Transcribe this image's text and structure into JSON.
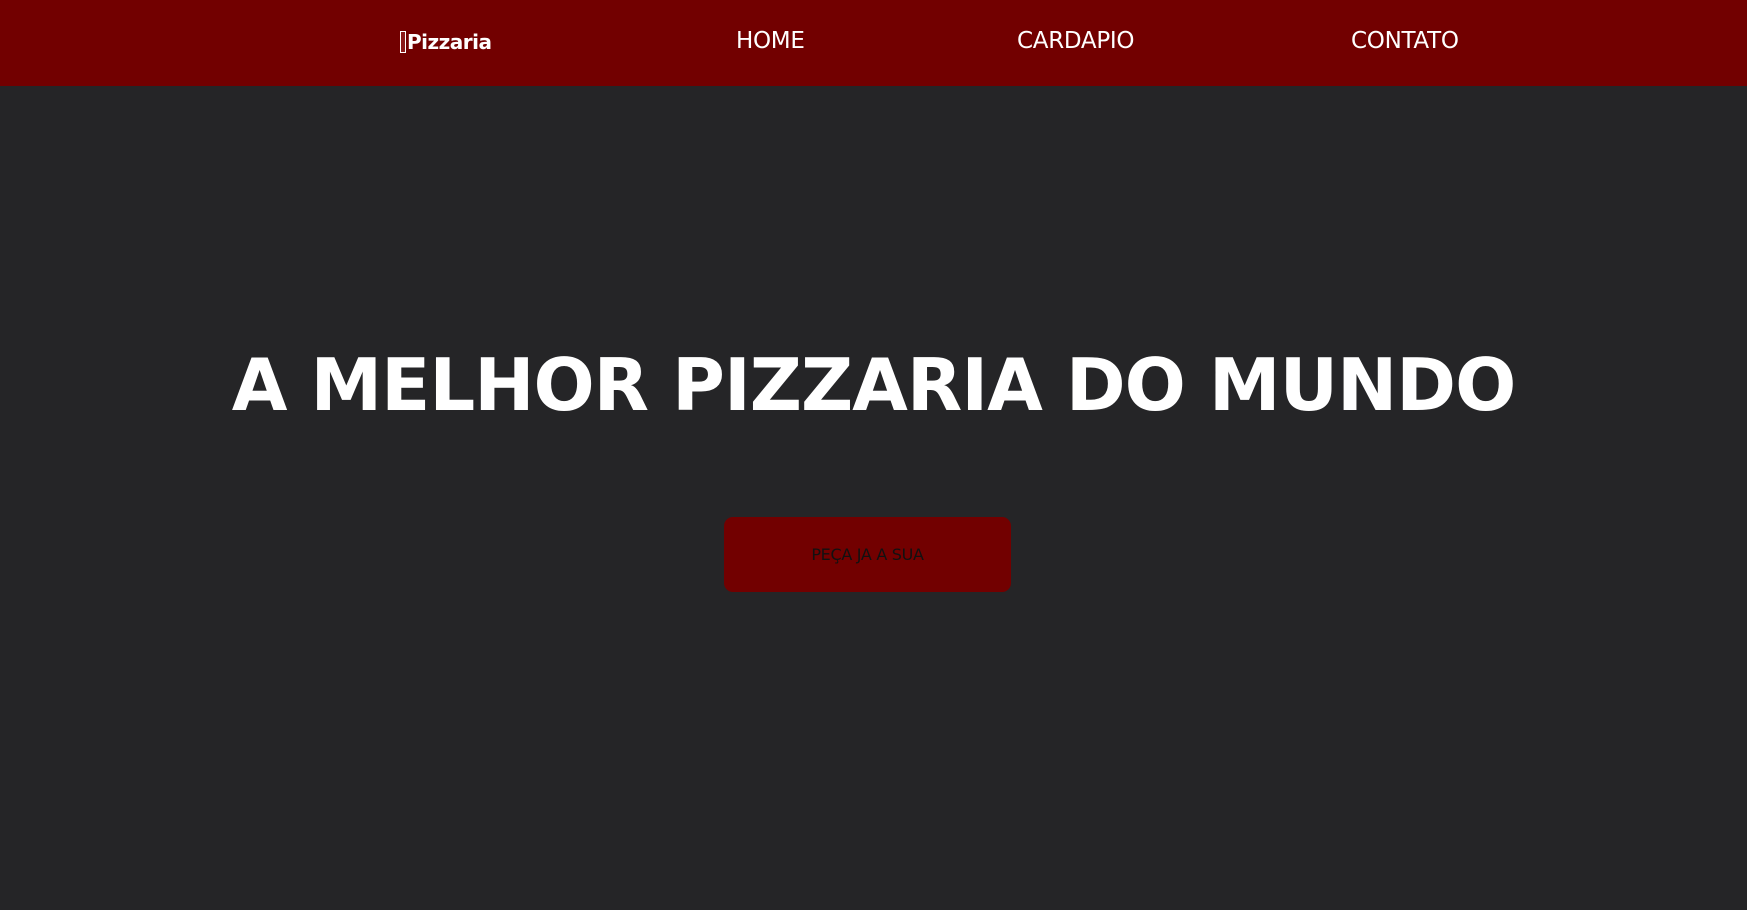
{
  "navbar": {
    "brand": "Pizzaria",
    "brand_icon": "pizza-slice-icon",
    "links": [
      {
        "label": "HOME"
      },
      {
        "label": "CARDAPIO"
      },
      {
        "label": "CONTATO"
      }
    ]
  },
  "hero": {
    "title": "A MELHOR PIZZARIA DO MUNDO",
    "cta_label": "PEÇA JA A SUA"
  },
  "colors": {
    "navbar_bg": "#720000",
    "page_bg": "#252527",
    "button_bg": "#720000",
    "text_light": "#ffffff",
    "button_text": "#111111"
  }
}
